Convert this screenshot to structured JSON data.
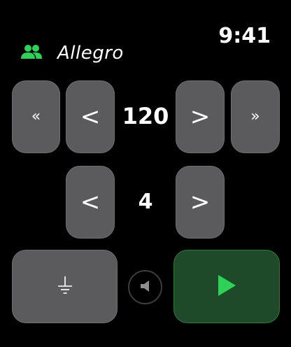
{
  "header": {
    "title": "Allegro",
    "time": "9:41",
    "group_icon": "people-icon"
  },
  "tempo": {
    "value": "120",
    "fast_decrease_label": "«",
    "decrease_label": "<",
    "increase_label": ">",
    "fast_increase_label": "»"
  },
  "beats": {
    "value": "4",
    "decrease_label": "<",
    "increase_label": ">"
  },
  "controls": {
    "tap_icon": "ground-icon",
    "mute_icon": "speaker-icon",
    "play_icon": "play-icon"
  },
  "colors": {
    "accent_green": "#30d158",
    "button_gray": "#5b5b5d",
    "play_bg": "#1f4a2a"
  }
}
